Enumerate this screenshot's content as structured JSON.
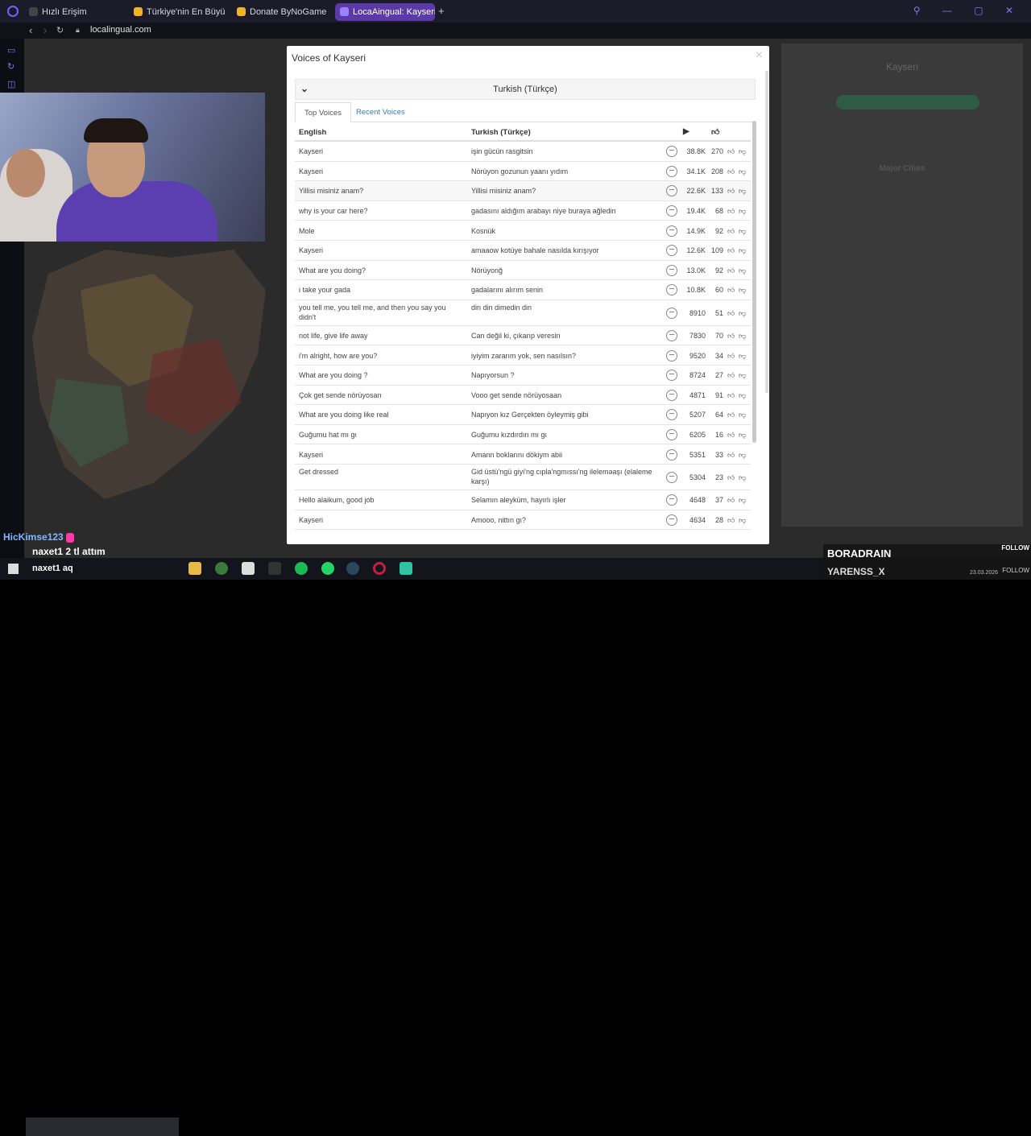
{
  "browser": {
    "tabs": [
      {
        "label": "Hızlı Erişim",
        "color": "#444"
      },
      {
        "label": "Türkiye'nin En Büyük Oyun",
        "color": "#f0b429"
      },
      {
        "label": "Donate ByNoGame - Gele",
        "color": "#f0b429"
      },
      {
        "label": "LocaAingual: Kayseri",
        "color": "#7b5cff"
      }
    ],
    "url": "localingual.com"
  },
  "modal": {
    "title": "Voices of Kayseri",
    "close": "×",
    "language": "Turkish (Türkçe)",
    "tabs": [
      "Top Voices",
      "Recent Voices"
    ],
    "columns": {
      "english": "English",
      "turkish": "Turkish (Türkçe)"
    },
    "rows": [
      {
        "en": "Kayseri",
        "tr": "işin gücün rasgitsin",
        "plays": "38.8K",
        "likes": "270"
      },
      {
        "en": "Kayseri",
        "tr": "Nörüyon gozunun yaanı yıdım",
        "plays": "34.1K",
        "likes": "208"
      },
      {
        "en": "Yillisi misiniz anam?",
        "tr": "Yillisi misiniz anam?",
        "plays": "22.6K",
        "likes": "133"
      },
      {
        "en": "why is your car here?",
        "tr": "gadasını aldığım arabayı niye buraya ağledin",
        "plays": "19.4K",
        "likes": "68"
      },
      {
        "en": "Mole",
        "tr": "Kosnük",
        "plays": "14.9K",
        "likes": "92"
      },
      {
        "en": "Kayseri",
        "tr": "amaaow kotüye bahale nasılda kırışıyor",
        "plays": "12.6K",
        "likes": "109"
      },
      {
        "en": "What are you doing?",
        "tr": "Nörüyonğ",
        "plays": "13.0K",
        "likes": "92"
      },
      {
        "en": "i take your gada",
        "tr": "gadalarını alırım senin",
        "plays": "10.8K",
        "likes": "60"
      },
      {
        "en": "you tell me, you tell me, and then you say you didn't",
        "tr": "din din dimedin din",
        "plays": "8910",
        "likes": "51"
      },
      {
        "en": "not life, give life away",
        "tr": "Can değil ki, çıkarıp veresin",
        "plays": "7830",
        "likes": "70"
      },
      {
        "en": "i'm alright, how are you?",
        "tr": "iyiyim zararım yok, sen nasılsın?",
        "plays": "9520",
        "likes": "34"
      },
      {
        "en": "What are you doing ?",
        "tr": "Napıyorsun ?",
        "plays": "8724",
        "likes": "27"
      },
      {
        "en": "Çok get sende nörüyosan",
        "tr": "Vooo get sende nörüyosaan",
        "plays": "4871",
        "likes": "91"
      },
      {
        "en": "What are you doing like real",
        "tr": "Napıyon kız Gerçekten öyleymiş gibi",
        "plays": "5207",
        "likes": "64"
      },
      {
        "en": "Guğumu hat mı gı",
        "tr": "Guğumu kızdırdın mı gı",
        "plays": "6205",
        "likes": "16"
      },
      {
        "en": "Kayseri",
        "tr": "Amann boklarını dökiym abii",
        "plays": "5351",
        "likes": "33"
      },
      {
        "en": "Get dressed",
        "tr": "Gid üstü'ngü giyi'ng cıpla'ngmıssı'ng ileleməaşı (elaleme karşı)",
        "plays": "5304",
        "likes": "23"
      },
      {
        "en": "Hello alaikum, good job",
        "tr": "Selamın aleyküm, hayırlı işler",
        "plays": "4648",
        "likes": "37"
      },
      {
        "en": "Kayseri",
        "tr": "Amooo, nittın gı?",
        "plays": "4634",
        "likes": "28"
      }
    ]
  },
  "backdrop": {
    "right_title": "Kayseri",
    "major_cities": "Major Cities"
  },
  "chat": [
    {
      "user": "HicKimse123",
      "msg": ""
    },
    {
      "user": "naxet1",
      "msg": "2 tl attım"
    },
    {
      "user": "naxet1",
      "msg": "aq"
    }
  ],
  "stream": {
    "name1": "BORADRAIN",
    "name2": "YARENSS_X",
    "follow": "FOLLOW",
    "date": "23.03.2026"
  }
}
